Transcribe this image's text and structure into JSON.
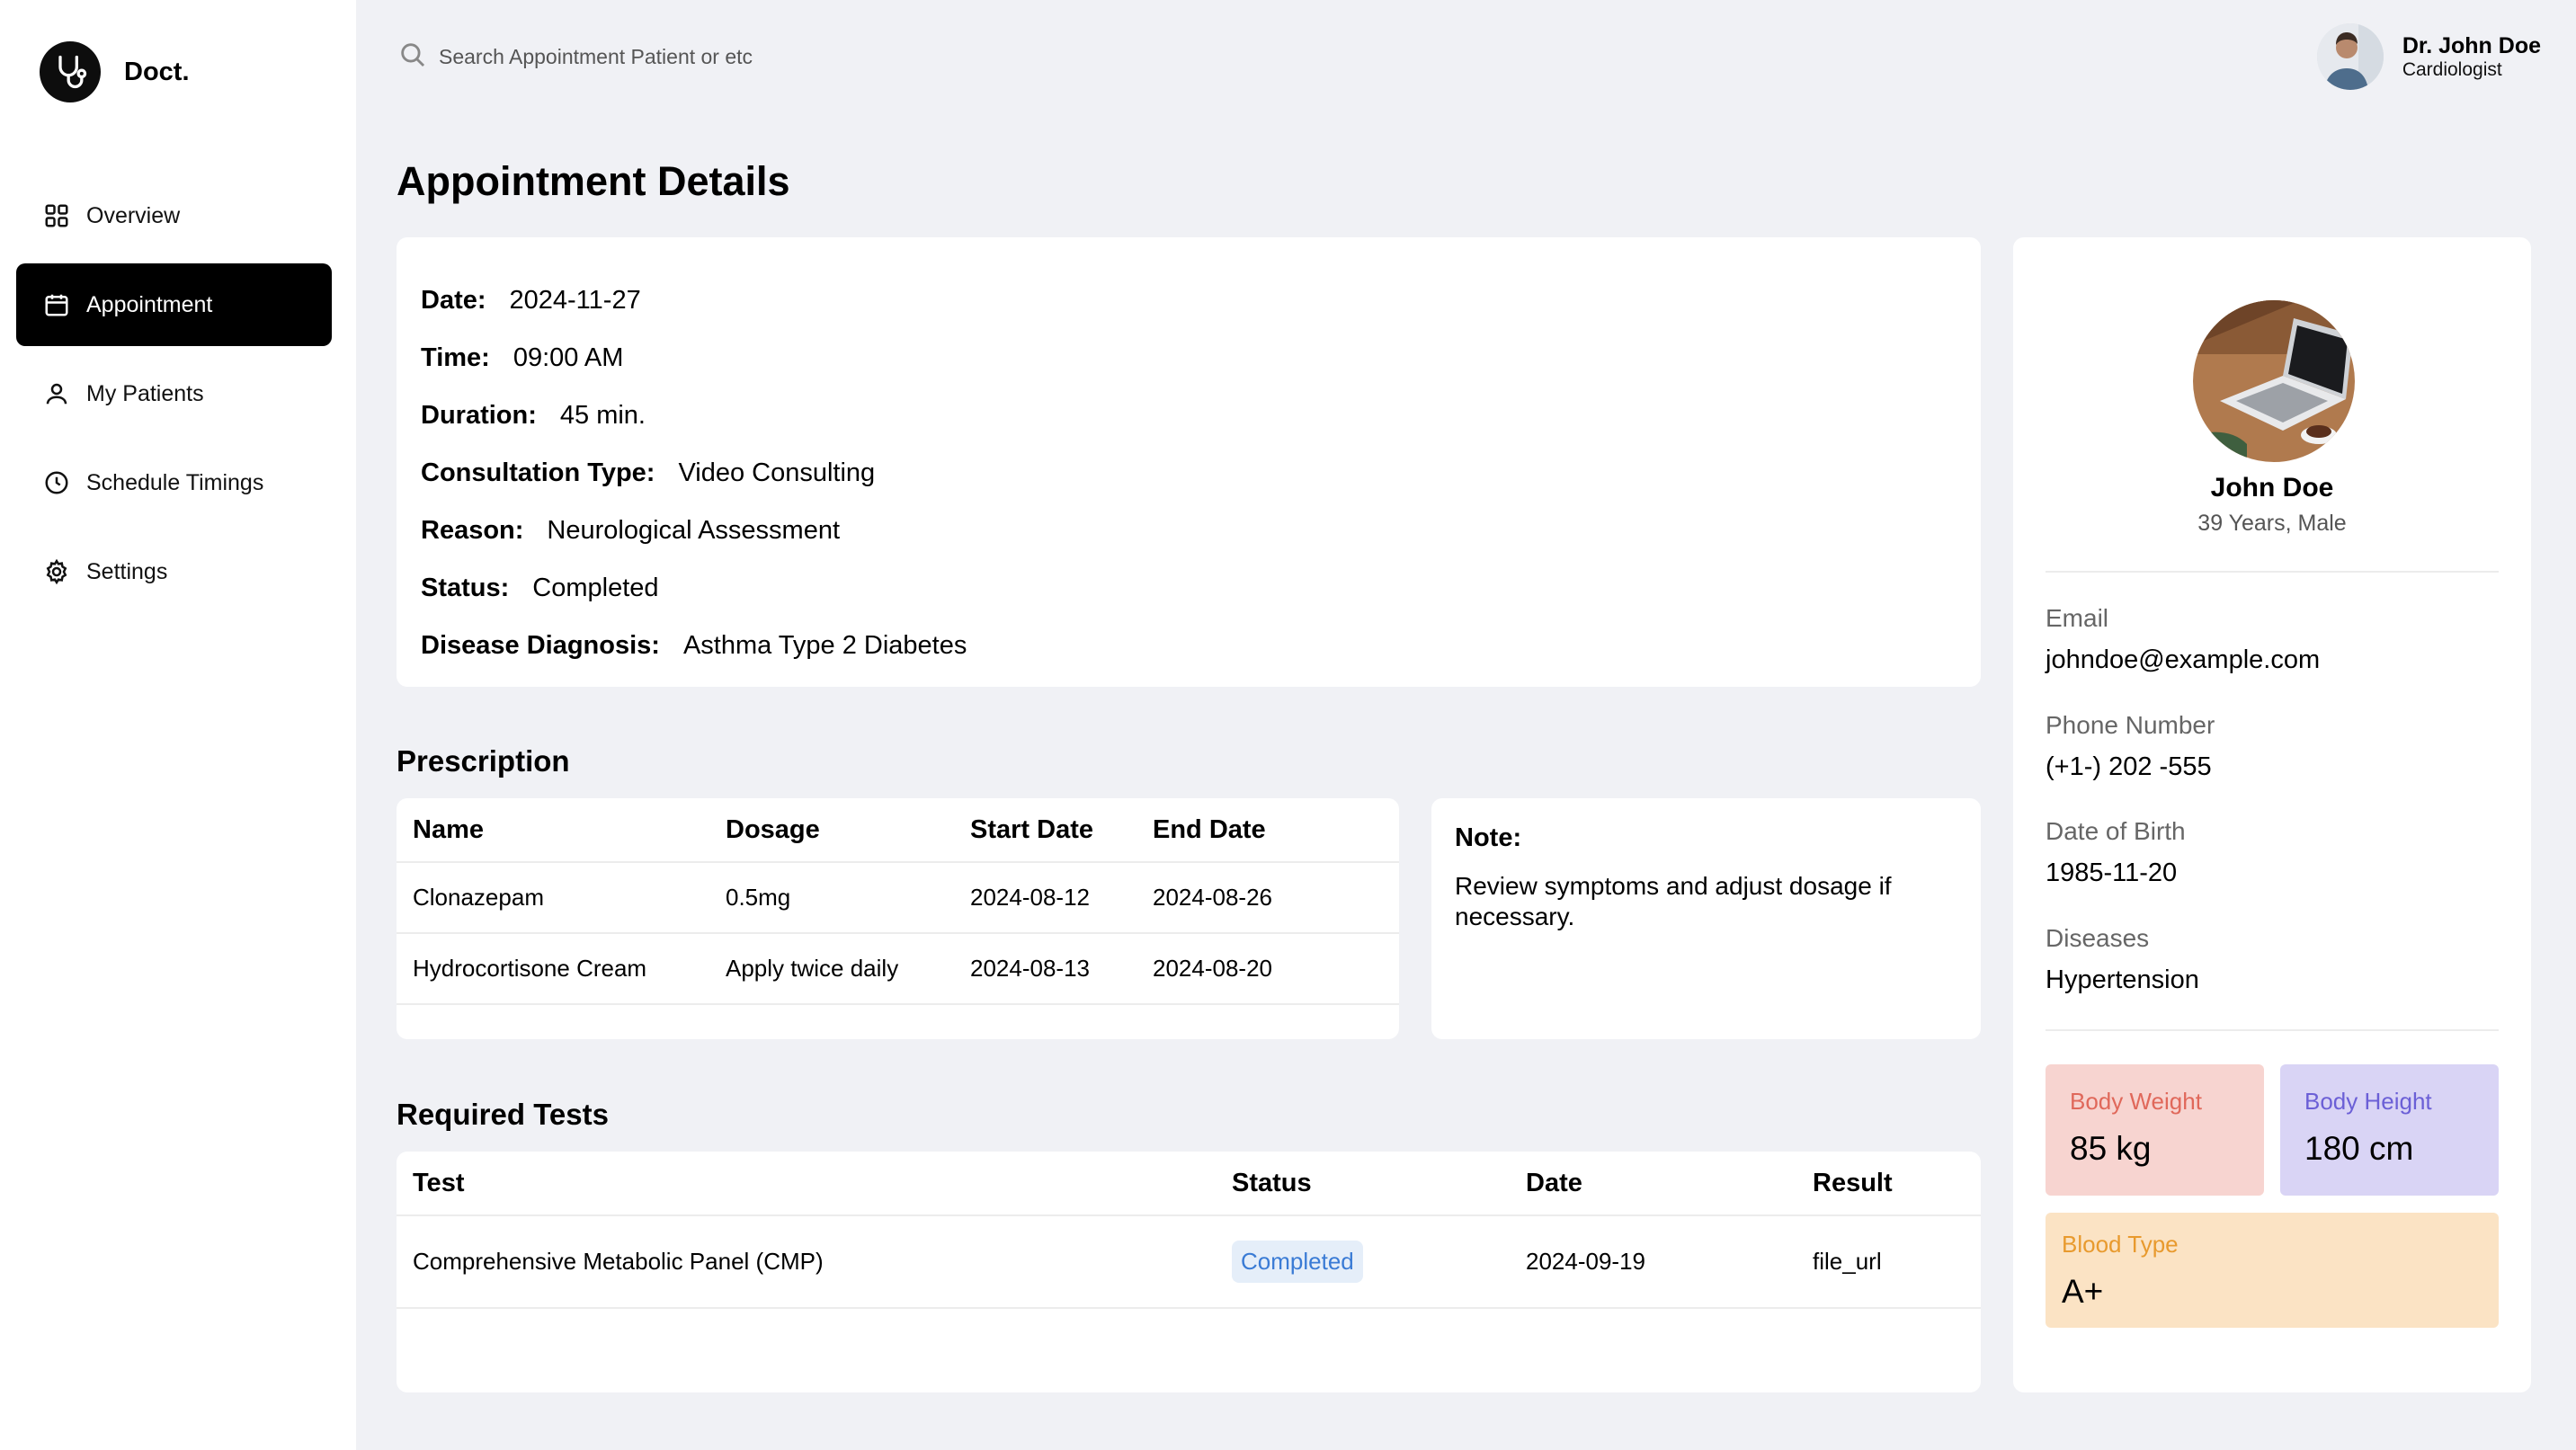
{
  "brand": {
    "name": "Doct."
  },
  "nav": {
    "items": [
      {
        "label": "Overview",
        "icon": "grid-icon"
      },
      {
        "label": "Appointment",
        "icon": "calendar-icon",
        "active": true
      },
      {
        "label": "My Patients",
        "icon": "user-icon"
      },
      {
        "label": "Schedule Timings",
        "icon": "clock-icon"
      },
      {
        "label": "Settings",
        "icon": "gear-icon"
      }
    ]
  },
  "search": {
    "placeholder": "Search Appointment Patient or etc"
  },
  "user": {
    "name": "Dr. John Doe",
    "role": "Cardiologist"
  },
  "page": {
    "title": "Appointment Details"
  },
  "details": {
    "date_label": "Date:",
    "date": "2024-11-27",
    "time_label": "Time:",
    "time": "09:00 AM",
    "duration_label": "Duration:",
    "duration": "45 min.",
    "consultation_label": "Consultation Type:",
    "consultation": "Video Consulting",
    "reason_label": "Reason:",
    "reason": "Neurological Assessment",
    "status_label": "Status:",
    "status": "Completed",
    "diagnosis_label": "Disease Diagnosis:",
    "diagnosis": "Asthma Type 2 Diabetes"
  },
  "prescription": {
    "title": "Prescription",
    "columns": [
      "Name",
      "Dosage",
      "Start Date",
      "End Date"
    ],
    "rows": [
      [
        "Clonazepam",
        "0.5mg",
        "2024-08-12",
        "2024-08-26"
      ],
      [
        "Hydrocortisone Cream",
        "Apply twice daily",
        "2024-08-13",
        "2024-08-20"
      ]
    ]
  },
  "note": {
    "label": "Note:",
    "text": "Review symptoms and adjust dosage if necessary."
  },
  "tests": {
    "title": "Required Tests",
    "columns": [
      "Test",
      "Status",
      "Date",
      "Result"
    ],
    "rows": [
      [
        "Comprehensive Metabolic Panel (CMP)",
        "Completed",
        "2024-09-19",
        "file_url"
      ]
    ]
  },
  "patient": {
    "name": "John Doe",
    "meta": "39 Years, Male",
    "email_label": "Email",
    "email": "johndoe@example.com",
    "phone_label": "Phone Number",
    "phone": "(+1-) 202 -555",
    "dob_label": "Date of Birth",
    "dob": "1985-11-20",
    "diseases_label": "Diseases",
    "diseases": "Hypertension",
    "weight_label": "Body Weight",
    "weight": "85 kg",
    "height_label": "Body Height",
    "height": "180 cm",
    "blood_label": "Blood Type",
    "blood": "A+"
  },
  "colors": {
    "weight_bg": "#f7d4d0",
    "weight_fg": "#e0685a",
    "height_bg": "#d9d4f5",
    "height_fg": "#6b5fd6",
    "blood_bg": "#fbe3c4",
    "blood_fg": "#e89a2e",
    "badge_bg": "#e5eef9",
    "badge_fg": "#3a7bd5"
  }
}
